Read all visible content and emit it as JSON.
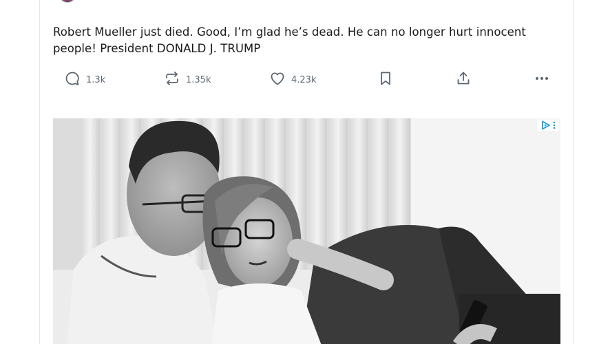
{
  "post": {
    "handle_partial": "@",
    "text": "Robert Mueller just died. Good, I’m glad he’s dead. He can no longer hurt innocent people! President DONALD J. TRUMP"
  },
  "actions": {
    "replies": "1.3k",
    "reposts": "1.35k",
    "likes": "4.23k"
  },
  "icons": [
    "comment-icon",
    "repost-icon",
    "heart-icon",
    "bookmark-icon",
    "share-icon",
    "more-icon",
    "adchoices-icon"
  ],
  "colors": {
    "text": "#1a1a1a",
    "muted": "#5b6670",
    "adchoices": "#1a9bd8",
    "border": "#e6e6e6"
  },
  "ad": {
    "image": "black-and-white photo of a couple on a sofa"
  }
}
